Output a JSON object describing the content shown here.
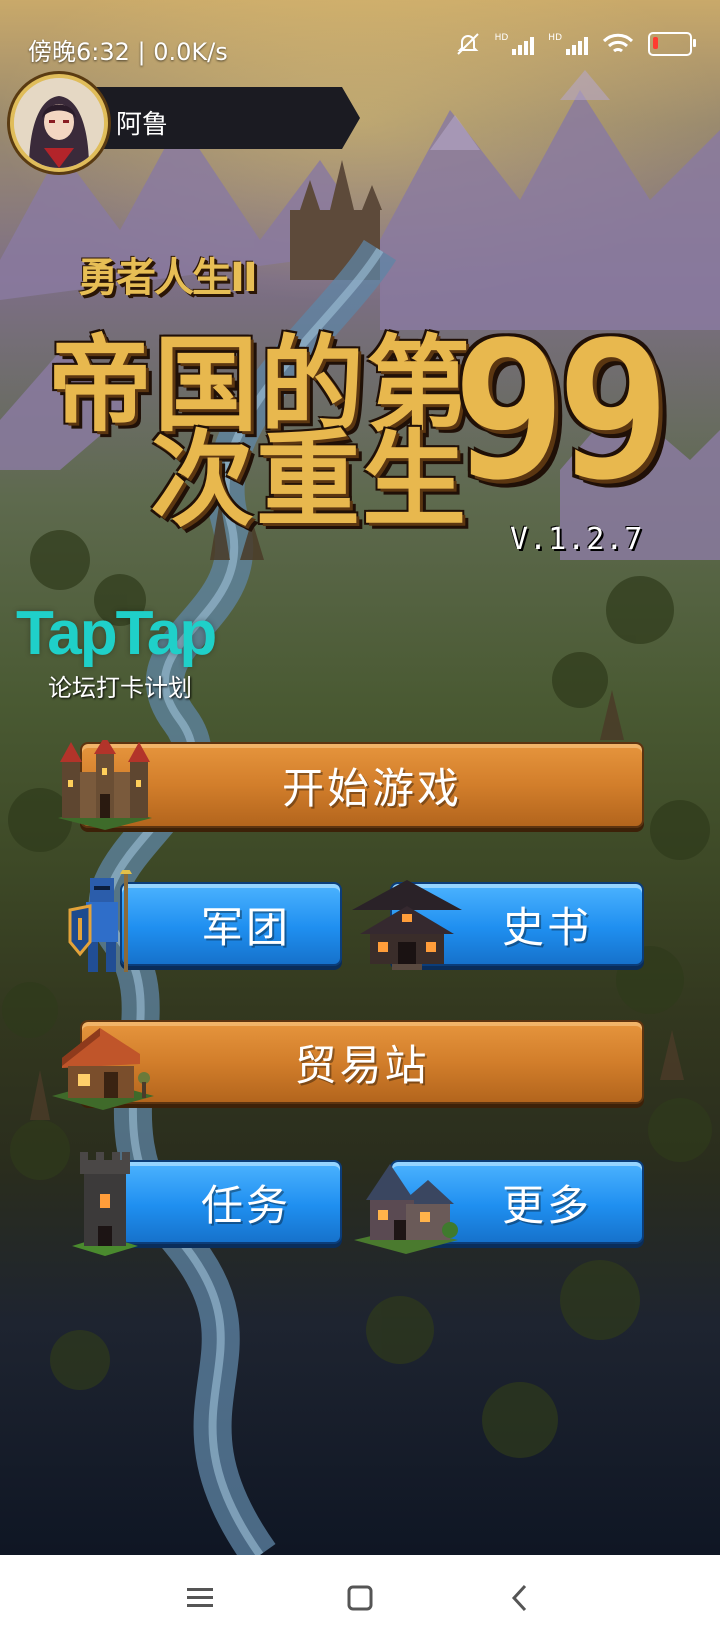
{
  "status_bar": {
    "time": "傍晚6:32 | 0.0K/s",
    "icons": [
      "mute-icon",
      "signal-hd-icon",
      "signal-hd-icon",
      "wifi-icon",
      "battery-low-icon"
    ],
    "battery_color": "#ff3b30"
  },
  "profile": {
    "name": "阿鲁"
  },
  "logo": {
    "subtitle": "勇者人生II",
    "title_line1": "帝国的第",
    "title_line2": "次重生",
    "title_number": "99",
    "version": "V.1.2.7"
  },
  "taptap": {
    "brand": "TapTap",
    "caption": "论坛打卡计划",
    "color": "#1fd0c9"
  },
  "menu": {
    "start": "开始游戏",
    "legion": "军团",
    "history": "史书",
    "trade": "贸易站",
    "quest": "任务",
    "more": "更多",
    "orange": "#d27e2b",
    "blue": "#1f8ff0"
  },
  "nav": {
    "icons": [
      "menu-icon",
      "home-icon",
      "back-icon"
    ]
  }
}
